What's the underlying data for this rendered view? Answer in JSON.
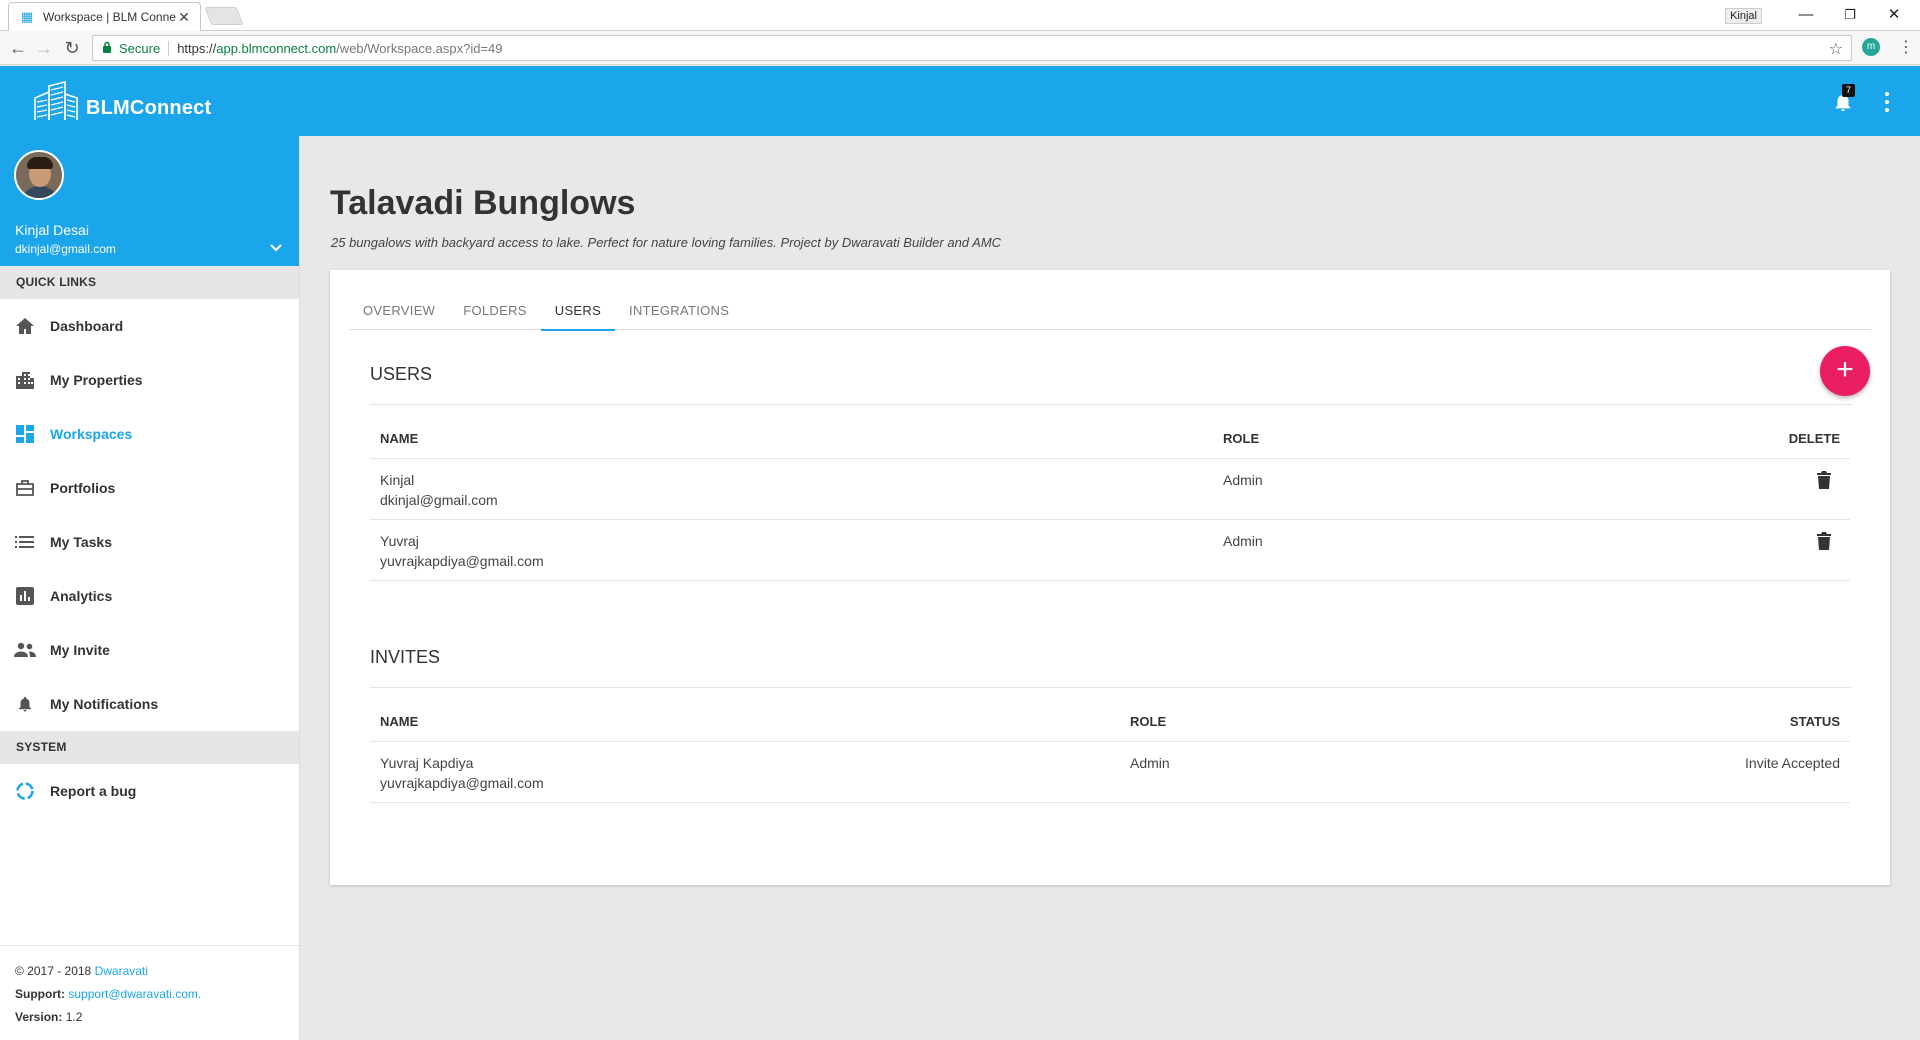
{
  "browser": {
    "tab_title": "Workspace | BLM Connect",
    "close_glyph": "✕",
    "window_user": "Kinjal",
    "secure_label": "Secure",
    "url_scheme": "https://",
    "url_host": "app.blmconnect.com",
    "url_path": "/web/Workspace.aspx?id=49",
    "extension_letter": "m"
  },
  "app": {
    "brand": "BLMConnect",
    "notification_count": "7",
    "accent_color": "#1ba5ea",
    "fab_color": "#e91e63"
  },
  "profile": {
    "name": "Kinjal Desai",
    "email": "dkinjal@gmail.com"
  },
  "sidebar": {
    "quick_links_title": "QUICK LINKS",
    "items": [
      {
        "label": "Dashboard",
        "icon": "home-icon"
      },
      {
        "label": "My Properties",
        "icon": "building-icon"
      },
      {
        "label": "Workspaces",
        "icon": "dashboard-icon",
        "active": true
      },
      {
        "label": "Portfolios",
        "icon": "briefcase-icon"
      },
      {
        "label": "My Tasks",
        "icon": "list-icon"
      },
      {
        "label": "Analytics",
        "icon": "chart-icon"
      },
      {
        "label": "My Invite",
        "icon": "people-icon"
      },
      {
        "label": "My Notifications",
        "icon": "bell-icon"
      }
    ],
    "system_title": "SYSTEM",
    "system_items": [
      {
        "label": "Report a bug",
        "icon": "bug-report-icon"
      }
    ]
  },
  "footer": {
    "copyright": "© 2017 - 2018",
    "company": "Dwaravati",
    "support_label": "Support:",
    "support_email": "support@dwaravati.com.",
    "version_label": "Version:",
    "version": "1.2"
  },
  "page": {
    "title": "Talavadi Bunglows",
    "subtitle": "25 bungalows with backyard access to lake. Perfect for nature loving families. Project by Dwaravati Builder and AMC"
  },
  "tabs": [
    "OVERVIEW",
    "FOLDERS",
    "USERS",
    "INTEGRATIONS"
  ],
  "users": {
    "title": "USERS",
    "add_glyph": "+",
    "columns": {
      "name": "NAME",
      "role": "ROLE",
      "delete": "DELETE"
    },
    "rows": [
      {
        "name": "Kinjal",
        "email": "dkinjal@gmail.com",
        "role": "Admin"
      },
      {
        "name": "Yuvraj",
        "email": "yuvrajkapdiya@gmail.com",
        "role": "Admin"
      }
    ]
  },
  "invites": {
    "title": "INVITES",
    "columns": {
      "name": "NAME",
      "role": "ROLE",
      "status": "STATUS"
    },
    "rows": [
      {
        "name": "Yuvraj Kapdiya",
        "email": "yuvrajkapdiya@gmail.com",
        "role": "Admin",
        "status": "Invite Accepted"
      }
    ]
  }
}
